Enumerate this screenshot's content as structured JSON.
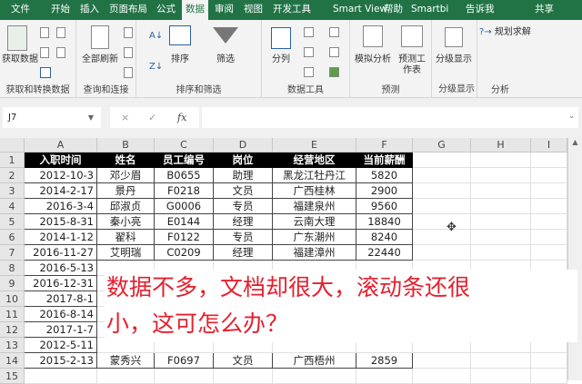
{
  "tabs": [
    "文件",
    "开始",
    "插入",
    "页面布局",
    "公式",
    "数据",
    "审阅",
    "视图",
    "开发工具",
    "Smart View",
    "帮助",
    "Smartbi",
    "告诉我",
    "共享"
  ],
  "active_tab": "数据",
  "ribbon": {
    "groups": [
      "获取和转换数据",
      "查询和连接",
      "排序和筛选",
      "数据工具",
      "预测",
      "分级显示",
      "分析"
    ],
    "get_data": "获取数据",
    "refresh_all": "全部刷新",
    "sort": "排序",
    "filter": "筛选",
    "text_to_columns": "分列",
    "what_if": "模拟分析",
    "forecast_sheet": "预测工作表",
    "outline": "分级显示",
    "solver": "规划求解"
  },
  "formula_bar": {
    "name_box": "J7",
    "cancel": "×",
    "enter": "✓",
    "fx": "fx",
    "value": ""
  },
  "columns": [
    "A",
    "B",
    "C",
    "D",
    "E",
    "F",
    "G",
    "H",
    "I"
  ],
  "rows": [
    "1",
    "2",
    "3",
    "4",
    "5",
    "6",
    "7",
    "8",
    "9",
    "10",
    "11",
    "12",
    "13",
    "14",
    "15"
  ],
  "table": {
    "headers": [
      "入职时间",
      "姓名",
      "员工编号",
      "岗位",
      "经营地区",
      "当前薪酬"
    ],
    "rows": [
      [
        "2012-10-3",
        "邓少眉",
        "B0655",
        "助理",
        "黑龙江牡丹江",
        "5820"
      ],
      [
        "2014-2-17",
        "景丹",
        "F0218",
        "文员",
        "广西桂林",
        "2900"
      ],
      [
        "2016-3-4",
        "邱淑贞",
        "G0006",
        "专员",
        "福建泉州",
        "9560"
      ],
      [
        "2015-8-31",
        "秦小亮",
        "E0144",
        "经理",
        "云南大理",
        "18840"
      ],
      [
        "2014-1-12",
        "翟科",
        "F0122",
        "专员",
        "广东潮州",
        "8240"
      ],
      [
        "2016-11-27",
        "艾明瑞",
        "C0209",
        "经理",
        "福建漳州",
        "22440"
      ],
      [
        "2016-5-13",
        "",
        "",
        "",
        "",
        ""
      ],
      [
        "2016-12-31",
        "",
        "",
        "",
        "",
        ""
      ],
      [
        "2017-8-1",
        "",
        "",
        "",
        "",
        ""
      ],
      [
        "2016-8-14",
        "",
        "",
        "",
        "",
        ""
      ],
      [
        "2017-1-7",
        "",
        "",
        "",
        "",
        ""
      ],
      [
        "2012-5-11",
        "",
        "",
        "",
        "",
        ""
      ],
      [
        "2015-2-13",
        "蒙秀兴",
        "F0697",
        "文员",
        "广西梧州",
        "2859"
      ]
    ]
  },
  "overlay_text": [
    "数据不多，文档却很大，滚动条还很",
    "小，这可怎么办？"
  ],
  "colors": {
    "ribbon_green": "#217346",
    "overlay_red": "#e5202e"
  }
}
